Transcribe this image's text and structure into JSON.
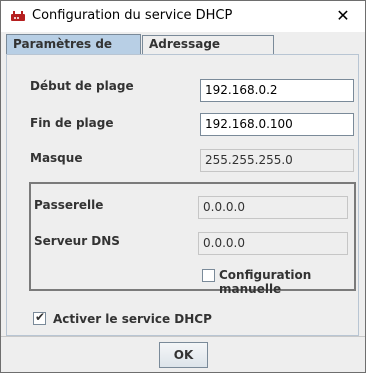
{
  "window": {
    "title": "Configuration du service DHCP",
    "close_glyph": "✕",
    "icon": "router-icon"
  },
  "tabs": [
    {
      "label": "Paramètres de base",
      "active": true
    },
    {
      "label": "Adressage statique",
      "active": false
    }
  ],
  "form": {
    "start_label": "Début de plage",
    "start_value": "192.168.0.2",
    "end_label": "Fin de plage",
    "end_value": "192.168.0.100",
    "mask_label": "Masque",
    "mask_value": "255.255.255.0"
  },
  "group": {
    "gateway_label": "Passerelle",
    "gateway_value": "0.0.0.0",
    "dns_label": "Serveur DNS",
    "dns_value": "0.0.0.0",
    "manual_label": "Configuration manuelle",
    "manual_checked": false
  },
  "enable": {
    "label": "Activer le service DHCP",
    "checked": true,
    "check_glyph": "✔"
  },
  "ok_label": "OK",
  "colors": {
    "tab_active": "#b8cfe5",
    "window_bg": "#eeeeee",
    "border": "#7a8a99"
  }
}
